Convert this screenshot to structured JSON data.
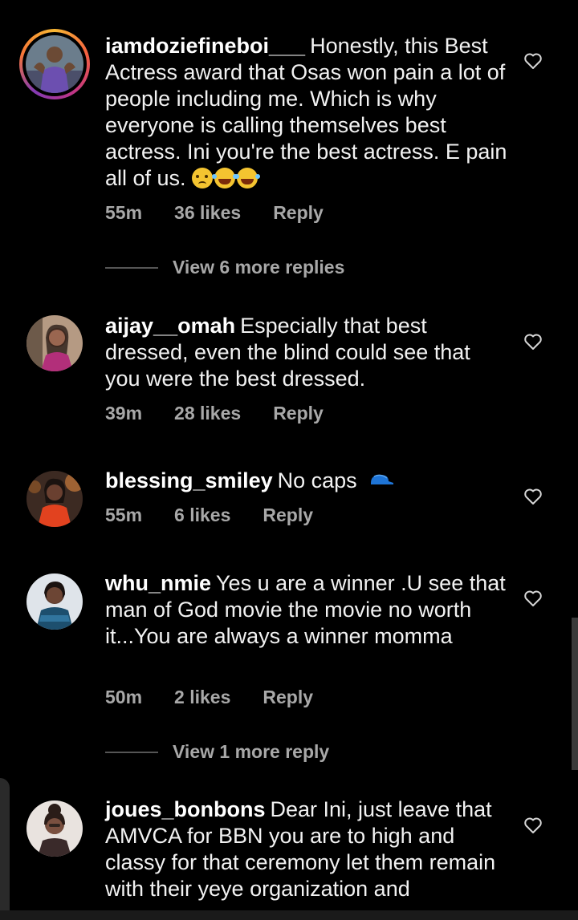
{
  "comments": [
    {
      "username": "iamdoziefineboi___",
      "text": "Honestly, this Best Actress award that Osas won pain a lot of people including me. Which is why everyone is calling themselves best actress. Ini you're the best actress. E pain all of us.",
      "emojis": [
        "crying-face",
        "tears-of-joy",
        "tears-of-joy"
      ],
      "time": "55m",
      "likes": "36 likes",
      "reply": "Reply",
      "has_story_ring": true
    },
    {
      "username": "aijay__omah",
      "text": "Especially that best dressed, even the blind could see that you were the best dressed.",
      "time": "39m",
      "likes": "28 likes",
      "reply": "Reply"
    },
    {
      "username": "blessing_smiley",
      "text": "No caps",
      "emojis": [
        "billed-cap"
      ],
      "time": "55m",
      "likes": "6 likes",
      "reply": "Reply"
    },
    {
      "username": "whu_nmie",
      "text": "Yes u are a winner .U see that man of God movie the movie no worth it...You are always a winner momma",
      "time": "50m",
      "likes": "2 likes",
      "reply": "Reply"
    },
    {
      "username": "joues_bonbons",
      "text": "Dear Ini, just leave that AMVCA for BBN you are to high and classy for that ceremony let them remain with their yeye organization and"
    }
  ],
  "view_more": [
    {
      "label": "View 6 more replies"
    },
    {
      "label": "View 1 more reply"
    }
  ],
  "icons": {
    "like": "heart-outline-icon"
  },
  "colors": {
    "background": "#000000",
    "text": "#f2f2f2",
    "meta": "#a8a8a8"
  }
}
